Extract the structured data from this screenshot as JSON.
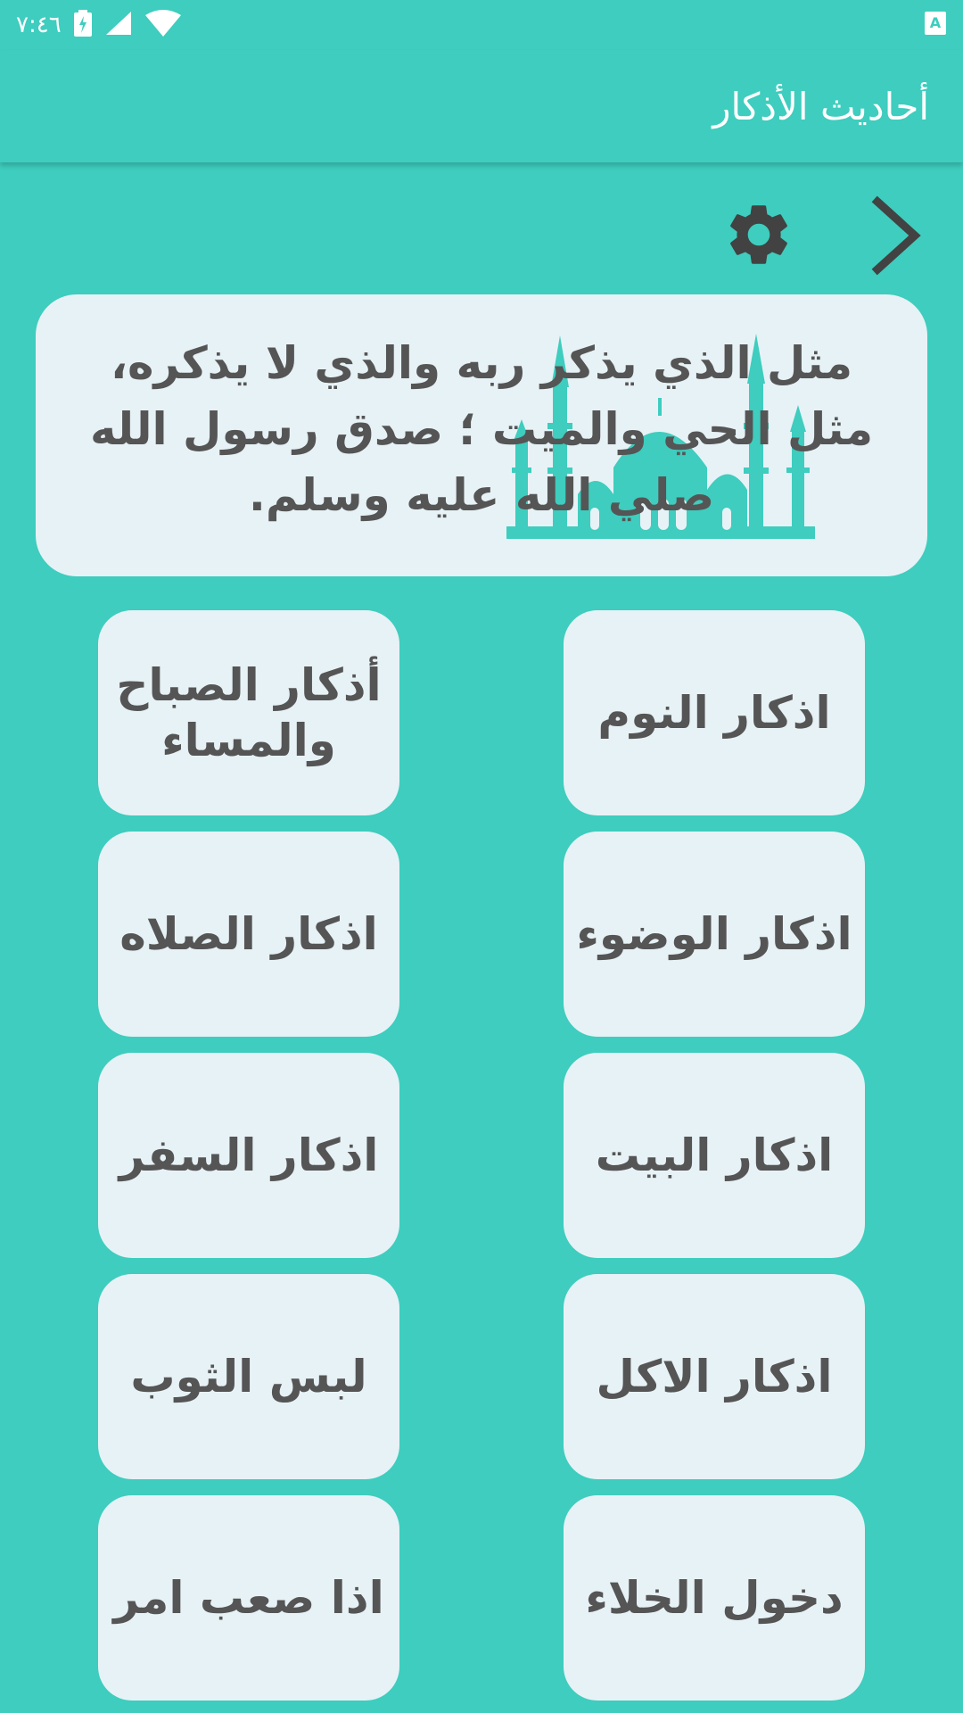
{
  "status_bar": {
    "time": "٧:٤٦",
    "icons": [
      "battery-charging-icon",
      "cell-signal-icon",
      "wifi-icon",
      "keyboard-indicator-icon"
    ]
  },
  "app_bar": {
    "title": "أحاديث الأذكار"
  },
  "toolbar": {
    "icons": [
      "settings-gear-icon",
      "chevron-right-icon"
    ]
  },
  "quote": {
    "text": "مثل الذي يذكر ربه والذي لا يذكره، مثل الحي والميت ؛ صدق رسول الله صلي الله عليه وسلم."
  },
  "buttons": [
    {
      "label": "أذكار الصباح والمساء"
    },
    {
      "label": "اذكار النوم"
    },
    {
      "label": "اذكار الصلاه"
    },
    {
      "label": "اذكار الوضوء"
    },
    {
      "label": "اذكار السفر"
    },
    {
      "label": "اذكار البيت"
    },
    {
      "label": "لبس الثوب"
    },
    {
      "label": "اذكار الاكل"
    },
    {
      "label": "اذا صعب امر"
    },
    {
      "label": "دخول الخلاء"
    }
  ],
  "colors": {
    "background": "#3ECDBE",
    "card": "#E7F2F6",
    "text": "#555555",
    "icon": "#424242"
  }
}
